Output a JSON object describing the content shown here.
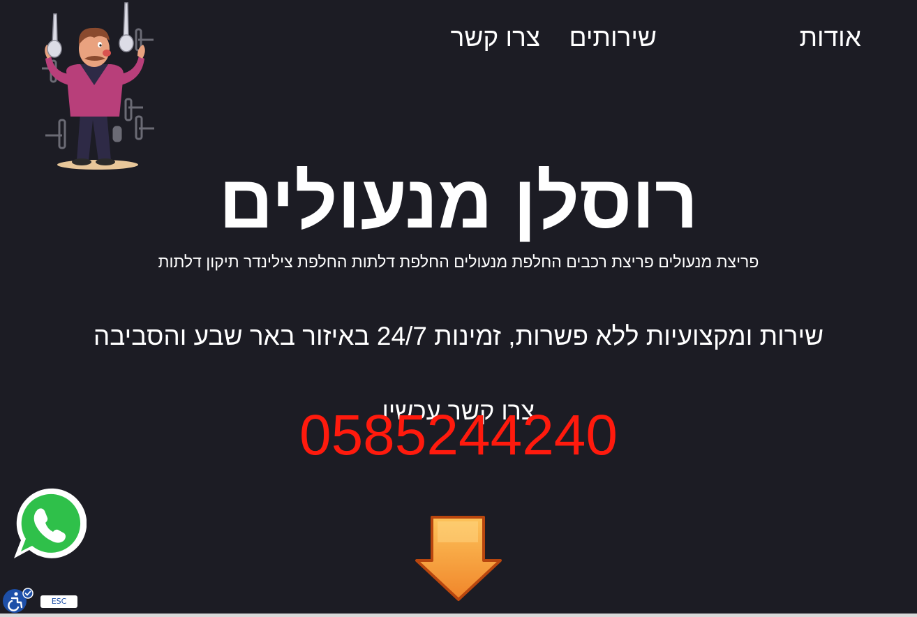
{
  "nav": {
    "about_label": "אודות",
    "services_label": "שירותים",
    "contact_label": "צרו קשר"
  },
  "hero": {
    "title": "רוסלן מנעולים",
    "services_line": "פריצת מנעולים פריצת רכבים החלפת מנעולים החלפת דלתות החלפת צילינדר תיקון דלתות",
    "tagline": "שירות ומקצועיות ללא פשרות, זמינות 24/7 באיזור באר שבע והסביבה",
    "contact_now": "צרו קשר עכשיו",
    "phone": "0585244240"
  },
  "widgets": {
    "whatsapp_icon": "whatsapp-icon",
    "accessibility_icon": "accessibility-icon",
    "esc_label": "ESC"
  },
  "colors": {
    "background": "#1c1c24",
    "text": "#ffffff",
    "phone": "#ff1a0d",
    "whatsapp": "#2fc04a",
    "arrow": "#f7a23a",
    "accessibility": "#1d4fa8"
  }
}
